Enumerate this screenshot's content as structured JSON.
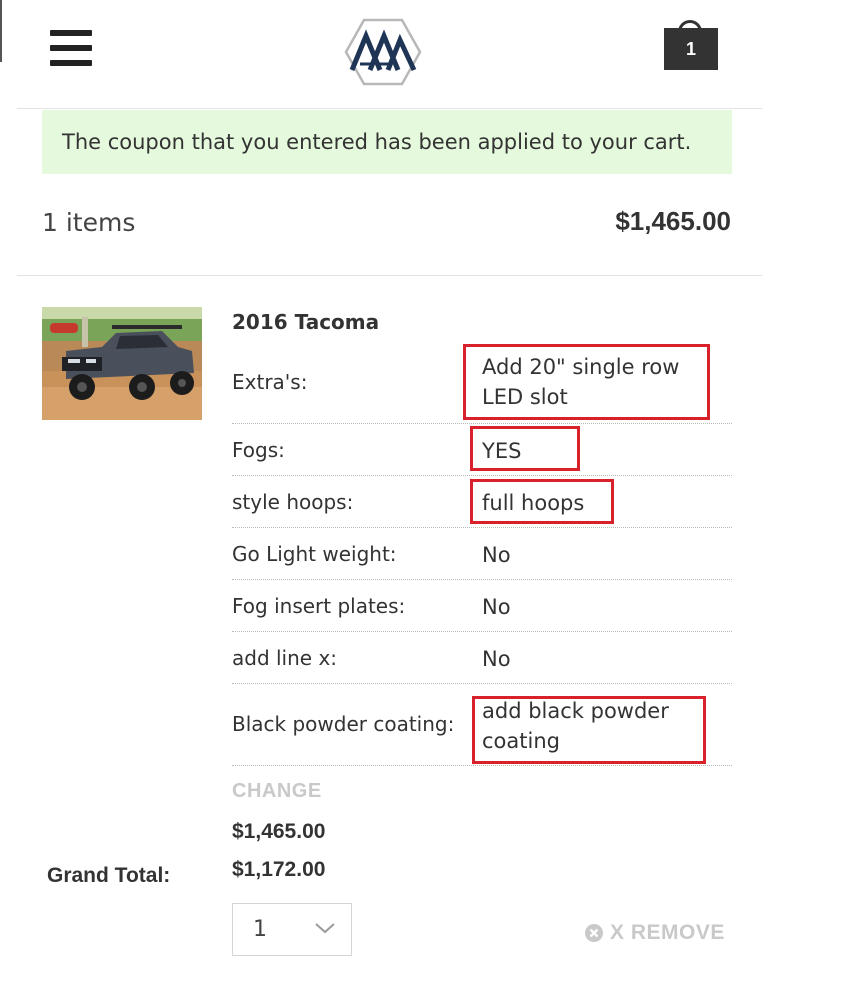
{
  "header": {
    "cart_count": "1"
  },
  "notice": {
    "message": "The coupon that you entered has been applied to your cart."
  },
  "summary": {
    "items_count": "1 items",
    "total": "$1,465.00"
  },
  "product": {
    "name": "2016 Tacoma",
    "options": [
      {
        "label": "Extra's:",
        "value": "Add 20\" single row LED slot",
        "highlighted": true
      },
      {
        "label": "Fogs:",
        "value": "YES",
        "highlighted": true
      },
      {
        "label": "style hoops:",
        "value": "full hoops",
        "highlighted": true
      },
      {
        "label": "Go Light weight:",
        "value": "No",
        "highlighted": false
      },
      {
        "label": "Fog insert plates:",
        "value": "No",
        "highlighted": false
      },
      {
        "label": "add line x:",
        "value": "No",
        "highlighted": false
      },
      {
        "label": "Black powder coating:",
        "value": "add black powder coating",
        "highlighted": true
      }
    ],
    "change_label": "CHANGE",
    "price": "$1,465.00",
    "grand_total_label": "Grand Total:",
    "grand_total": "$1,172.00",
    "quantity": "1",
    "remove_label": "X REMOVE"
  },
  "colors": {
    "highlight_box": "#d9212c",
    "notice_bg": "#e5f9dd",
    "logo_navy": "#1f3556",
    "muted_action": "#c9c9c9"
  },
  "icons": {
    "menu": "hamburger-icon",
    "logo": "brand-logo",
    "cart": "cart-bag-icon",
    "dropdown": "chevron-down-icon",
    "remove": "close-circle-icon"
  }
}
